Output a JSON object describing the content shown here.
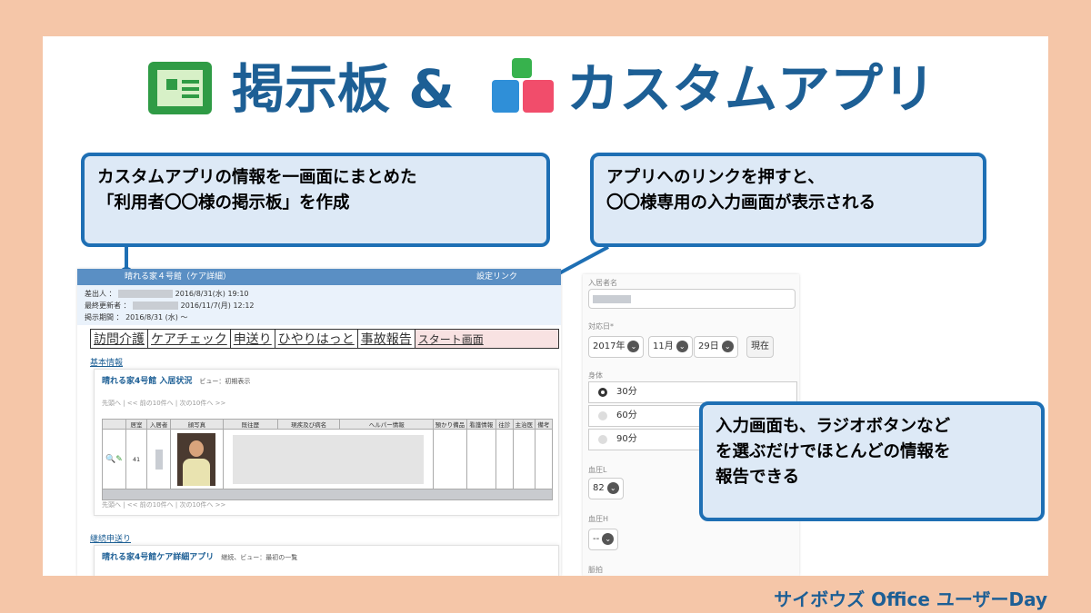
{
  "title": {
    "part1": "掲示板 &",
    "part2": "カスタムアプリ"
  },
  "callouts": {
    "left": {
      "line1": "カスタムアプリの情報を一画面にまとめた",
      "line2": "「利用者〇〇様の掲示板」を作成"
    },
    "top_right": {
      "line1": "アプリへのリンクを押すと、",
      "line2": "〇〇様専用の入力画面が表示される"
    },
    "bottom_right": {
      "line1": "入力画面も、ラジオボタンなど",
      "line2": "を選ぶだけでほとんどの情報を",
      "line3": "報告できる"
    }
  },
  "board": {
    "header_title": "晴れる家４号館（ケア詳細）",
    "header_link": "設定リンク",
    "meta": {
      "creator_label": "差出人",
      "creator_date": "2016/8/31(水) 19:10",
      "updater_label": "最終更新者",
      "updater_date": "2016/11/7(月) 12:12",
      "period_label": "掲示期間",
      "period_value": "2016/8/31 (水) ～"
    },
    "tabs": [
      "訪問介護",
      "ケアチェック",
      "申送り",
      "ひやりはっと",
      "事故報告",
      "スタート画面"
    ],
    "section1": "基本情報",
    "panel1_title": "晴れる家4号館 入居状況",
    "panel1_note": "ビュー：初期表示",
    "pager_top": "先頭へ | << 前の10件へ | 次の10件へ >>",
    "pager_bottom": "先頭へ | << 前の10件へ | 次の10件へ >>",
    "columns": [
      "",
      "居室",
      "入居者",
      "顔写真",
      "既往歴",
      "現疾及び病名",
      "ヘルパー情報",
      "預かり備品",
      "看護情報",
      "往診",
      "主治医",
      "備考"
    ],
    "room_value": "41",
    "section2": "継続申送り",
    "panel2_title": "晴れる家4号館ケア詳細アプリ",
    "panel2_note": "継続、ビュー：最初の一覧"
  },
  "form": {
    "resident_label": "入居者名",
    "date_label": "対応日*",
    "year": "2017年",
    "month": "11月",
    "day": "29日",
    "now_button": "現在",
    "body_label": "身体",
    "radio_options": [
      "30分",
      "60分",
      "90分"
    ],
    "radio_selected": 0,
    "bp_low_label": "血圧L",
    "bp_low_value": "82",
    "bp_high_label": "血圧H",
    "bp_high_value": "--",
    "next_label": "脈拍"
  },
  "footer": "サイボウズ Office ユーザーDay",
  "colors": {
    "background": "#f5c6a8",
    "title": "#1d5f95",
    "callout_border": "#1e6fb4",
    "callout_fill": "#dde9f6"
  }
}
